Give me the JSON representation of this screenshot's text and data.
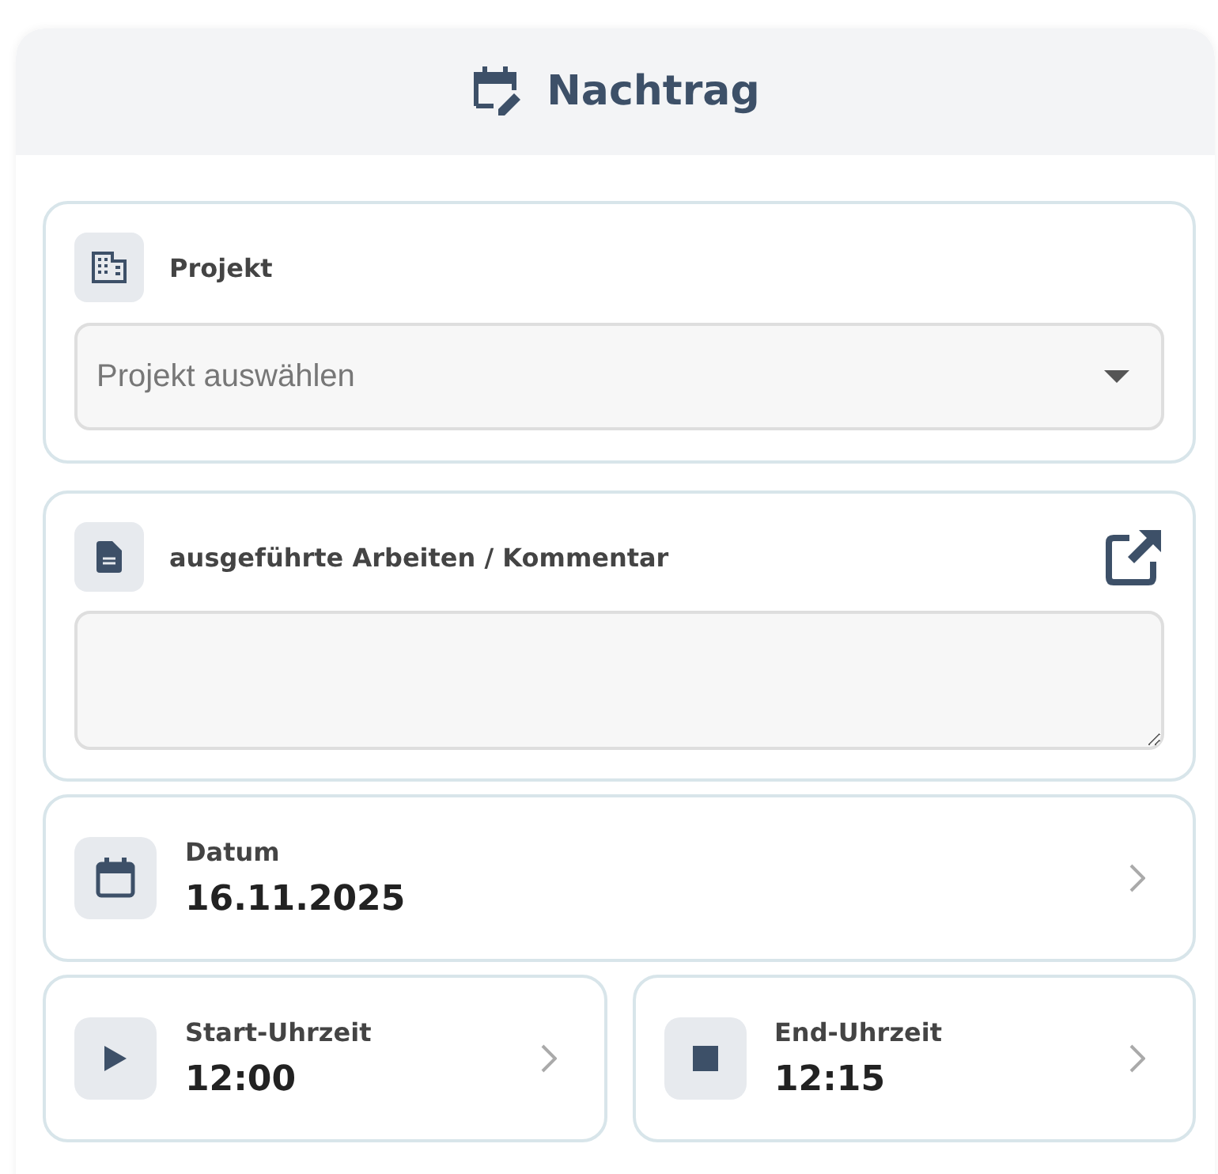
{
  "header": {
    "title": "Nachtrag"
  },
  "project": {
    "label": "Projekt",
    "placeholder": "Projekt auswählen"
  },
  "comment": {
    "label": "ausgeführte Arbeiten / Kommentar"
  },
  "date": {
    "label": "Datum",
    "value": "16.11.2025"
  },
  "times": [
    {
      "kind": "start",
      "label": "Start-Uhrzeit",
      "value": "12:00"
    },
    {
      "kind": "end",
      "label": "End-Uhrzeit",
      "value": "12:15"
    }
  ]
}
